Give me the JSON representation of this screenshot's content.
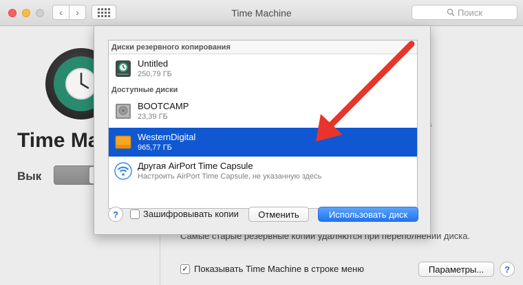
{
  "window": {
    "title": "Time Machine"
  },
  "search": {
    "placeholder": "Поиск",
    "icon": "search-icon"
  },
  "background": {
    "title": "Time Ma",
    "off_label": "Вык",
    "note": "Самые старые резервные копии удаляются при переполнении диска.",
    "partial_fragment": "а",
    "show_in_menu_label": "Показывать Time Machine в строке меню",
    "show_in_menu_checked": true,
    "options_button": "Параметры..."
  },
  "sheet": {
    "groups": [
      {
        "header": "Диски резервного копирования",
        "disks": [
          {
            "name": "Untitled",
            "size": "250,79 ГБ",
            "icon": "time-machine-disk-icon",
            "selected": false
          }
        ]
      },
      {
        "header": "Доступные диски",
        "disks": [
          {
            "name": "BOOTCAMP",
            "size": "23,39 ГБ",
            "icon": "internal-disk-icon",
            "selected": false
          },
          {
            "name": "WesternDigital",
            "size": "965,77 ГБ",
            "icon": "external-disk-icon",
            "selected": true
          },
          {
            "name": "Другая AirPort Time Capsule",
            "size": "Настроить AirPort Time Capsule, не указанную здесь",
            "icon": "airport-wifi-icon",
            "selected": false
          }
        ]
      }
    ],
    "encrypt_label": "Зашифровывать копии",
    "encrypt_checked": false,
    "cancel_button": "Отменить",
    "use_button": "Использовать диск",
    "help": "?"
  },
  "colors": {
    "selection": "#0f58d1",
    "accent": "#1f74f3",
    "arrow": "#e8342a"
  }
}
